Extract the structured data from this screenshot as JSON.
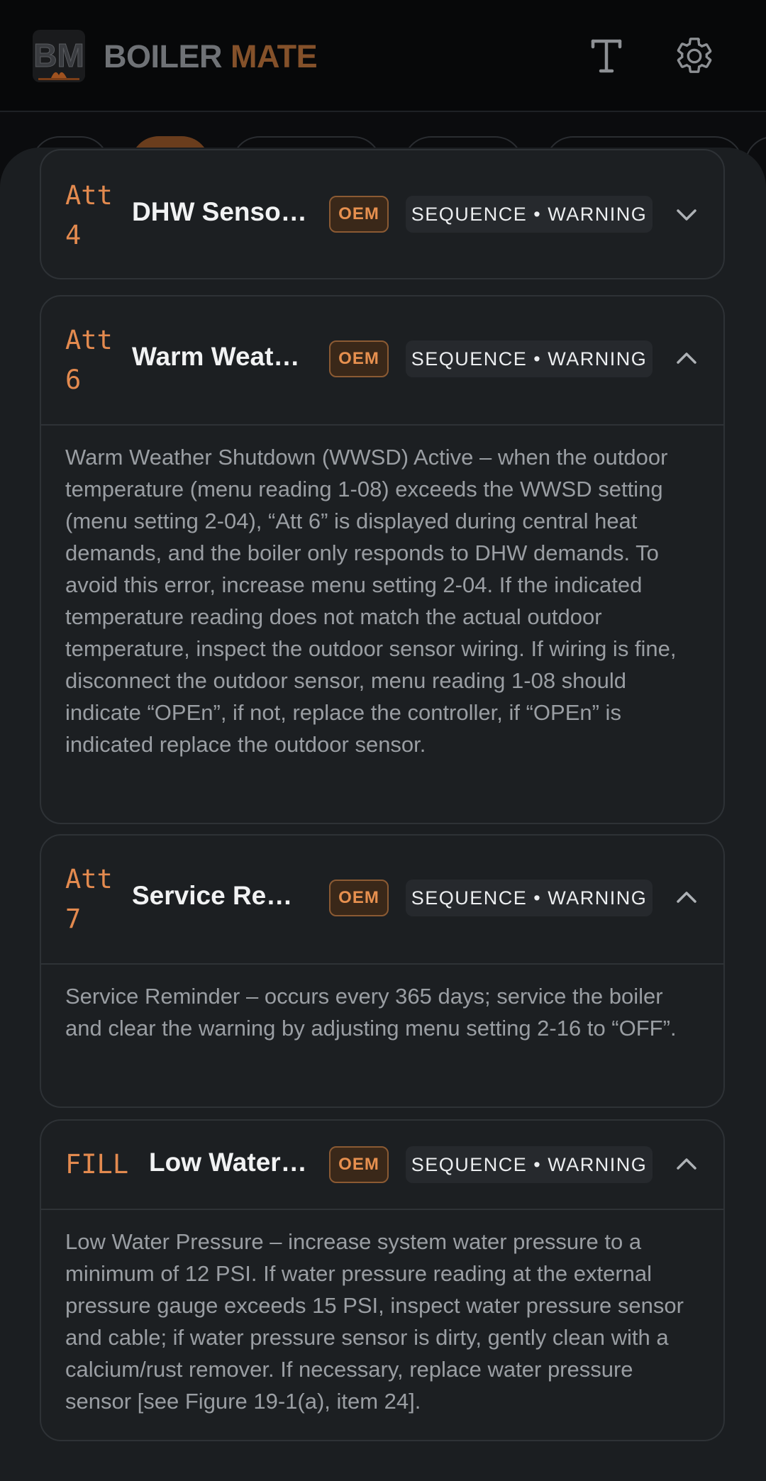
{
  "header": {
    "logo_text": "BM",
    "brand_part1": "BOILER",
    "brand_part2": "MATE",
    "colors": {
      "brand_gray": "#6f7276",
      "brand_orange": "#84512a",
      "accent": "#e38a4f"
    },
    "icons": {
      "text_size": "text-size-icon",
      "settings": "gear-icon"
    }
  },
  "cards": [
    {
      "code": "Att\n4",
      "title": "DHW Sensor…",
      "badge": "OEM",
      "tag": "SEQUENCE • WARNING",
      "expanded": false
    },
    {
      "code": "Att\n6",
      "title": "Warm Weath…",
      "badge": "OEM",
      "tag": "SEQUENCE • WARNING",
      "expanded": true,
      "description": "Warm Weather Shutdown (WWSD) Active – when the outdoor temperature (menu reading 1-08) exceeds the WWSD setting (menu setting 2-04), “Att 6” is displayed during central heat demands, and the boiler only responds to DHW demands. To avoid this error, increase menu setting 2-04. If the indicated temperature reading does not match the actual outdoor temperature, inspect the outdoor sensor wiring. If wiring is fine, disconnect the outdoor sensor, menu reading 1-08 should indicate “OPEn”, if not, replace the controller, if “OPEn” is indicated replace the outdoor sensor."
    },
    {
      "code": "Att\n7",
      "title": "Service Rem…",
      "badge": "OEM",
      "tag": "SEQUENCE • WARNING",
      "expanded": true,
      "description": "Service Reminder – occurs every 365 days; service the boiler and clear the warning by adjusting menu setting 2-16 to “OFF”."
    },
    {
      "code": "FILL",
      "title": "Low Water …",
      "badge": "OEM",
      "tag": "SEQUENCE • WARNING",
      "expanded": true,
      "description": "Low Water Pressure – increase system water pressure to a minimum of 12 PSI. If water pressure reading at the external pressure gauge exceeds 15 PSI, inspect water pressure sensor and cable; if water pressure sensor is dirty, gently clean with a calcium/rust remover. If necessary, replace water pressure sensor [see Figure 19-1(a), item 24]."
    }
  ]
}
